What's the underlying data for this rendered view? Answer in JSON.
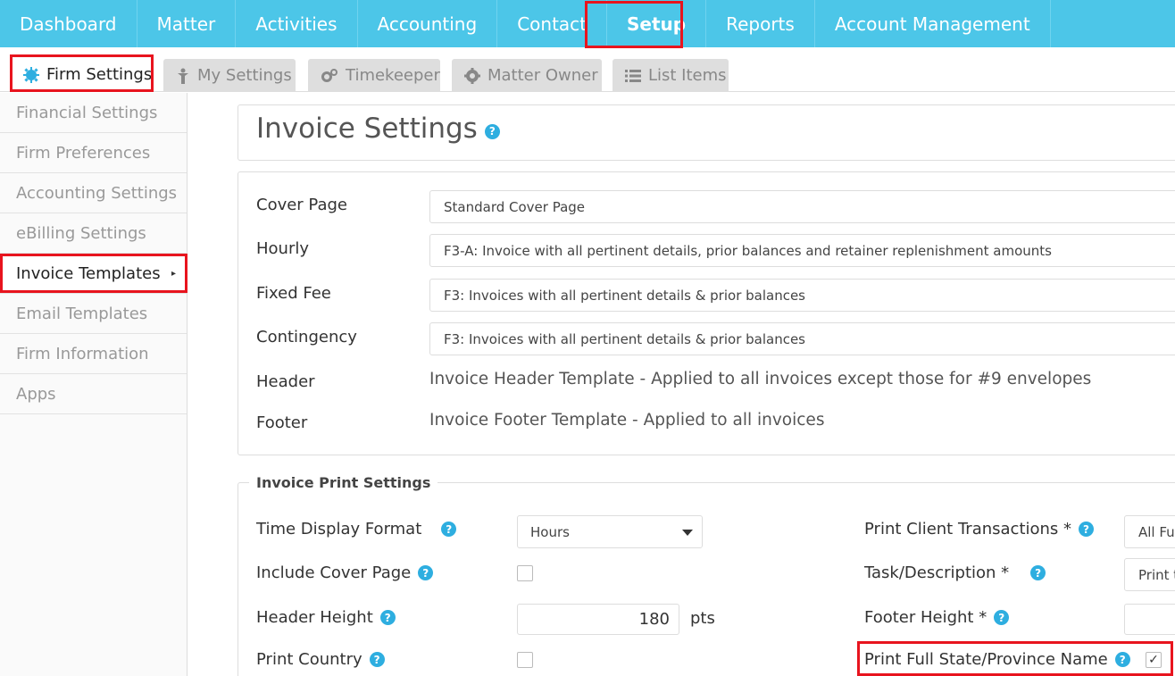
{
  "topnav": {
    "items": [
      "Dashboard",
      "Matter",
      "Activities",
      "Accounting",
      "Contact",
      "Setup",
      "Reports",
      "Account Management"
    ],
    "active": "Setup"
  },
  "tabs": {
    "firm_settings": "Firm Settings",
    "my_settings": "My Settings",
    "timekeeper": "Timekeeper",
    "matter_owner": "Matter Owner",
    "list_items": "List Items"
  },
  "sidebar": {
    "items": [
      "Financial Settings",
      "Firm Preferences",
      "Accounting Settings",
      "eBilling Settings",
      "Invoice Templates",
      "Email Templates",
      "Firm Information",
      "Apps"
    ],
    "active": "Invoice Templates"
  },
  "page": {
    "title": "Invoice Settings"
  },
  "templates": {
    "cover_page_label": "Cover Page",
    "cover_page_value": "Standard Cover Page",
    "hourly_label": "Hourly",
    "hourly_value": "F3-A: Invoice with all pertinent details, prior balances and retainer replenishment amounts",
    "fixed_fee_label": "Fixed Fee",
    "fixed_fee_value": "F3: Invoices with all pertinent details & prior balances",
    "contingency_label": "Contingency",
    "contingency_value": "F3: Invoices with all pertinent details & prior balances",
    "header_label": "Header",
    "header_value": "Invoice Header Template - Applied to all invoices except those for #9 envelopes",
    "footer_label": "Footer",
    "footer_value": "Invoice Footer Template - Applied to all invoices"
  },
  "print_settings": {
    "legend": "Invoice Print Settings",
    "time_display_format_label": "Time Display Format",
    "time_display_format_value": "Hours",
    "include_cover_page_label": "Include Cover Page",
    "include_cover_page_checked": false,
    "header_height_label": "Header Height",
    "header_height_value": "180",
    "header_height_unit": "pts",
    "print_country_label": "Print Country",
    "print_country_checked": false,
    "print_client_transactions_label": "Print Client Transactions *",
    "print_client_transactions_value": "All Fu",
    "task_description_label": "Task/Description *",
    "task_description_value": "Print t",
    "footer_height_label": "Footer Height *",
    "footer_height_value": "",
    "print_full_state_label": "Print Full State/Province Name",
    "print_full_state_checked": true,
    "check_mark": "✓"
  },
  "colors": {
    "nav_bg": "#4cc6e8",
    "help_icon": "#2eaee0",
    "highlight": "#e8141e"
  },
  "icons": {
    "help": "?",
    "caret": "▸"
  }
}
